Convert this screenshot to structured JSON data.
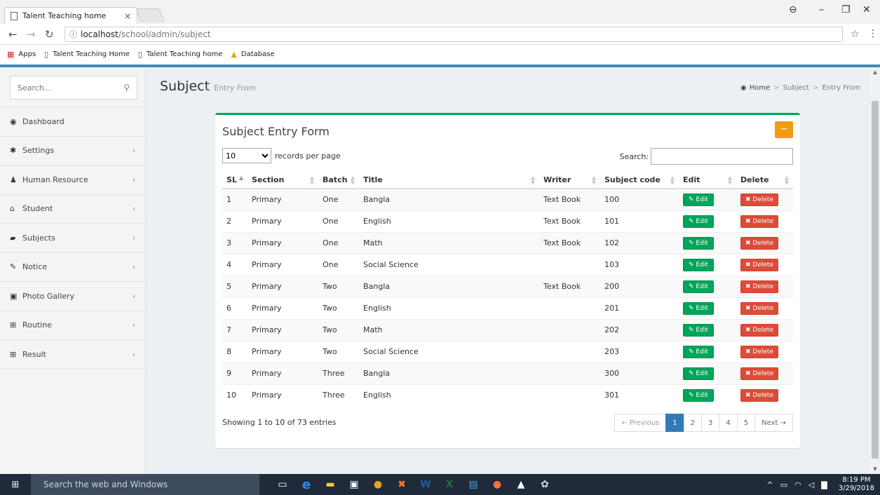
{
  "browser": {
    "tab_title": "Talent Teaching home",
    "tab_close": "×",
    "url_info_icon": "ⓘ",
    "url_host": "localhost",
    "url_path": "/school/admin/subject",
    "bookmarks": [
      {
        "icon": "apps-grid-icon",
        "label": "Apps"
      },
      {
        "icon": "page-icon",
        "label": "Talent Teaching Home"
      },
      {
        "icon": "page-icon",
        "label": "Talent Teaching home"
      },
      {
        "icon": "database-icon",
        "label": "Database"
      }
    ],
    "accent_color": "#3c8dbc"
  },
  "sidebar": {
    "search_placeholder": "Search...",
    "items": [
      {
        "label": "Dashboard",
        "icon": "dashboard-icon",
        "has_chevron": false
      },
      {
        "label": "Settings",
        "icon": "gear-icon",
        "has_chevron": true
      },
      {
        "label": "Human Resource",
        "icon": "user-icon",
        "has_chevron": true
      },
      {
        "label": "Student",
        "icon": "graduation-cap-icon",
        "has_chevron": true
      },
      {
        "label": "Subjects",
        "icon": "book-icon",
        "has_chevron": true
      },
      {
        "label": "Notice",
        "icon": "edit-icon",
        "has_chevron": true
      },
      {
        "label": "Photo Gallery",
        "icon": "image-icon",
        "has_chevron": true
      },
      {
        "label": "Routine",
        "icon": "table-icon",
        "has_chevron": true
      },
      {
        "label": "Result",
        "icon": "table-icon",
        "has_chevron": true
      }
    ]
  },
  "page": {
    "title": "Subject",
    "subtitle": "Entry From",
    "breadcrumb": [
      "Home",
      "Subject",
      "Entry From"
    ]
  },
  "box": {
    "title": "Subject Entry Form",
    "collapse_label": "−",
    "border_color": "#00a65a",
    "collapse_color": "#f39c12"
  },
  "table": {
    "length_value": "10",
    "length_suffix": "records per page",
    "search_label": "Search:",
    "columns": [
      "SL",
      "Section",
      "Batch",
      "Title",
      "Writer",
      "Subject code",
      "Edit",
      "Delete"
    ],
    "edit_label": "Edit",
    "delete_label": "Delete",
    "rows": [
      {
        "sl": "1",
        "section": "Primary",
        "batch": "One",
        "title": "Bangla",
        "writer": "Text Book",
        "code": "100"
      },
      {
        "sl": "2",
        "section": "Primary",
        "batch": "One",
        "title": "English",
        "writer": "Text Book",
        "code": "101"
      },
      {
        "sl": "3",
        "section": "Primary",
        "batch": "One",
        "title": "Math",
        "writer": "Text Book",
        "code": "102"
      },
      {
        "sl": "4",
        "section": "Primary",
        "batch": "One",
        "title": "Social Science",
        "writer": "",
        "code": "103"
      },
      {
        "sl": "5",
        "section": "Primary",
        "batch": "Two",
        "title": "Bangla",
        "writer": "Text Book",
        "code": "200"
      },
      {
        "sl": "6",
        "section": "Primary",
        "batch": "Two",
        "title": "English",
        "writer": "",
        "code": "201"
      },
      {
        "sl": "7",
        "section": "Primary",
        "batch": "Two",
        "title": "Math",
        "writer": "",
        "code": "202"
      },
      {
        "sl": "8",
        "section": "Primary",
        "batch": "Two",
        "title": "Social Science",
        "writer": "",
        "code": "203"
      },
      {
        "sl": "9",
        "section": "Primary",
        "batch": "Three",
        "title": "Bangla",
        "writer": "",
        "code": "300"
      },
      {
        "sl": "10",
        "section": "Primary",
        "batch": "Three",
        "title": "English",
        "writer": "",
        "code": "301"
      }
    ],
    "info": "Showing 1 to 10 of 73 entries",
    "pagination": {
      "previous": "← Previous",
      "pages": [
        "1",
        "2",
        "3",
        "4",
        "5"
      ],
      "active_page": "1",
      "next": "Next →"
    }
  },
  "taskbar": {
    "search_placeholder": "Search the web and Windows",
    "time": "8:19 PM",
    "date": "3/29/2018"
  }
}
